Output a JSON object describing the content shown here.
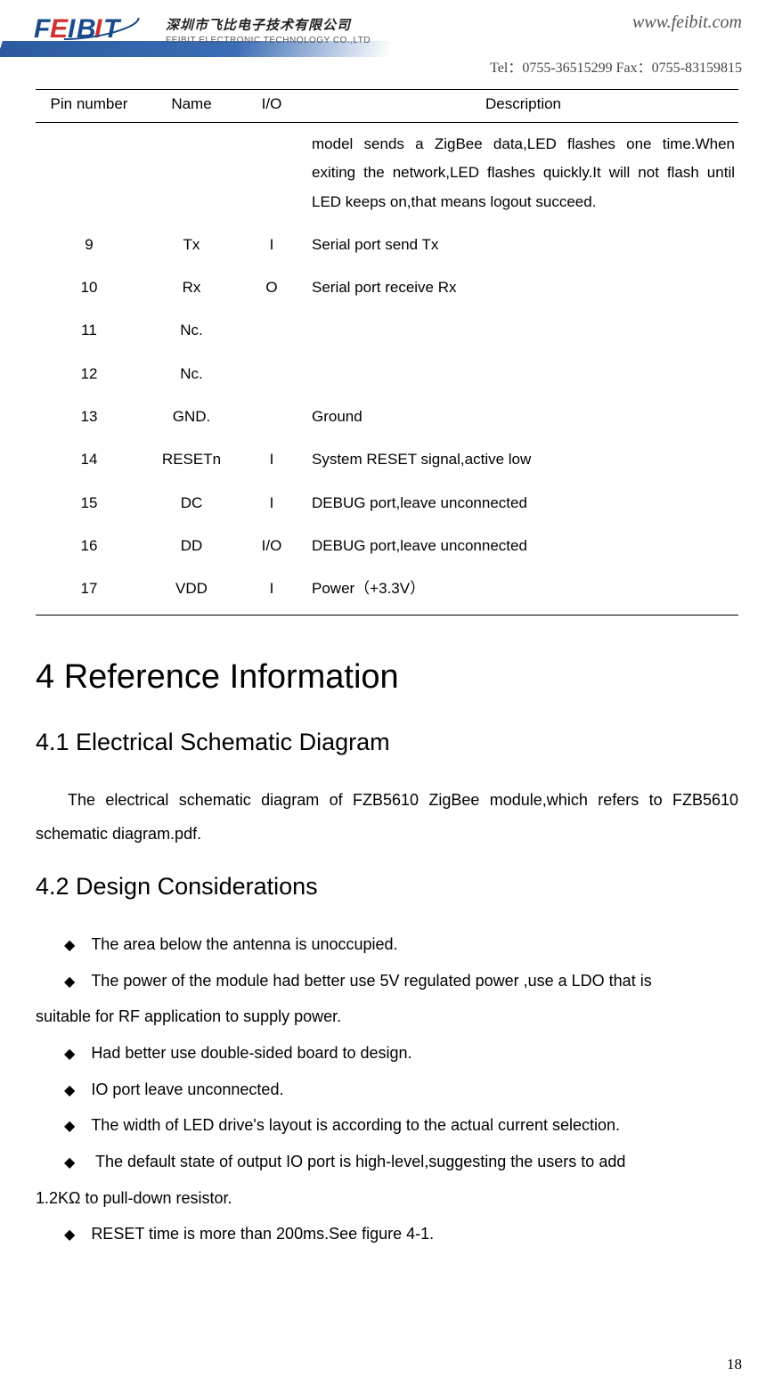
{
  "header": {
    "company_cn": "深圳市飞比电子技术有限公司",
    "company_en": "FEIBIT ELECTRONIC TECHNOLOGY CO.,LTD",
    "url": "www.feibit.com",
    "contact": "Tel：0755-36515299    Fax：0755-83159815"
  },
  "table": {
    "headers": {
      "pin": "Pin number",
      "name": "Name",
      "io": "I/O",
      "desc": "Description"
    },
    "rows": [
      {
        "pin": "",
        "name": "",
        "io": "",
        "desc": "model sends a ZigBee data,LED flashes one time.When exiting the network,LED flashes quickly.It will not flash until LED keeps on,that means logout succeed.",
        "justify": true
      },
      {
        "pin": "9",
        "name": "Tx",
        "io": "I",
        "desc": "Serial port send Tx"
      },
      {
        "pin": "10",
        "name": "Rx",
        "io": "O",
        "desc": "Serial port receive Rx"
      },
      {
        "pin": "11",
        "name": "Nc.",
        "io": "",
        "desc": ""
      },
      {
        "pin": "12",
        "name": "Nc.",
        "io": "",
        "desc": ""
      },
      {
        "pin": "13",
        "name": "GND.",
        "io": "",
        "desc": "Ground"
      },
      {
        "pin": "14",
        "name": "RESETn",
        "io": "I",
        "desc": "System RESET signal,active low"
      },
      {
        "pin": "15",
        "name": "DC",
        "io": "I",
        "desc": "DEBUG port,leave unconnected"
      },
      {
        "pin": "16",
        "name": "DD",
        "io": "I/O",
        "desc": "DEBUG port,leave unconnected"
      },
      {
        "pin": "17",
        "name": "VDD",
        "io": "I",
        "desc": "Power（+3.3V）"
      }
    ]
  },
  "sections": {
    "s4": "4    Reference Information",
    "s41": "4.1    Electrical Schematic Diagram",
    "s41_body": "The electrical schematic diagram of FZB5610 ZigBee module,which refers to FZB5610 schematic diagram.pdf.",
    "s42": "4.2    Design Considerations",
    "bullets": [
      "The area below the antenna is unoccupied.",
      "The power of the module had better use 5V regulated power ,use a LDO that is suitable for RF application to supply power.",
      "Had better use double-sided board to design.",
      "IO port leave unconnected.",
      "The width of LED drive's layout is according to the actual current selection.",
      " The default state of output IO port is high-level,suggesting the users to add 1.2KΩ to pull-down resistor.",
      "RESET time is more than 200ms.See figure 4-1."
    ],
    "bullet_cont": {
      "1": "suitable for RF application to supply power.",
      "5": "1.2KΩ to pull-down resistor."
    }
  },
  "page_number": "18"
}
